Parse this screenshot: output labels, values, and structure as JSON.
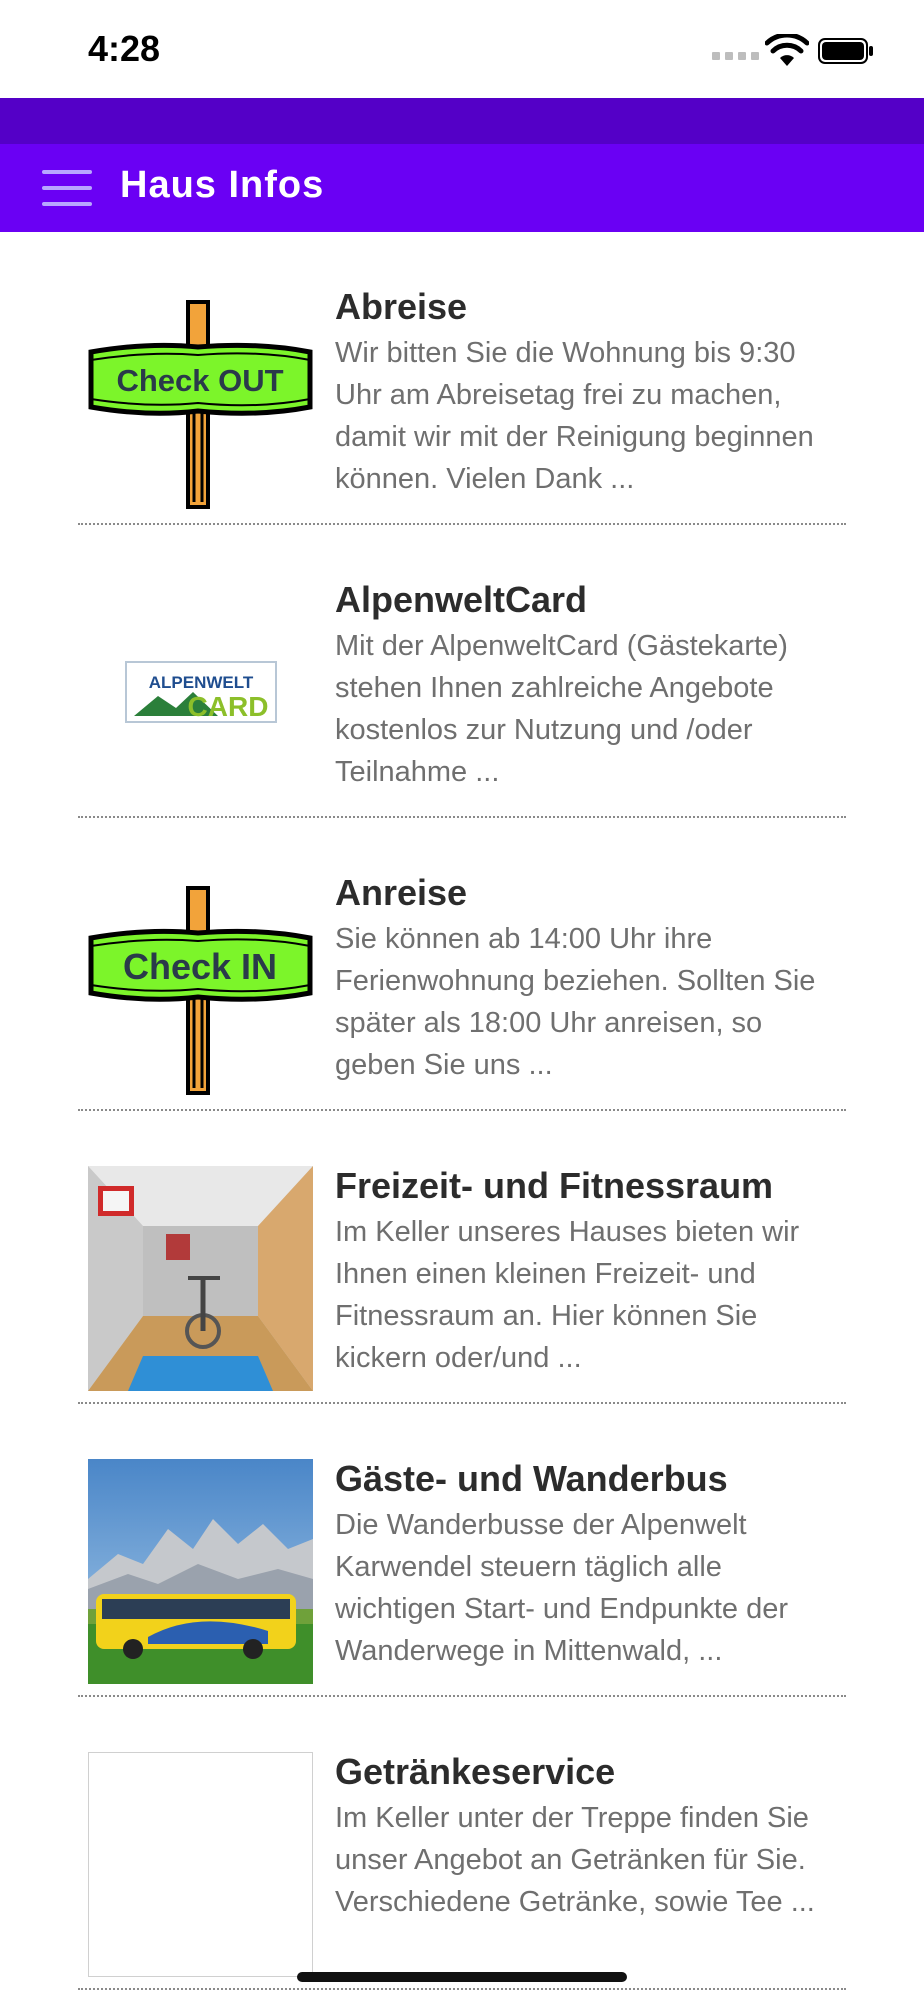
{
  "status": {
    "time": "4:28"
  },
  "header": {
    "title": "Haus Infos"
  },
  "items": [
    {
      "title": "Abreise",
      "desc": "Wir bitten Sie die Wohnung bis 9:30 Uhr am Abreisetag frei zu machen, damit wir mit der Reinigung beginnen können. Vielen Dank ...",
      "sign": "Check OUT"
    },
    {
      "title": "AlpenweltCard",
      "desc": "Mit der AlpenweltCard (Gästekarte) stehen Ihnen zahlreiche Angebote kostenlos zur Nutzung und /oder Teilnahme ...",
      "logo_top": "ALPENWELT",
      "logo_bottom": "CARD"
    },
    {
      "title": "Anreise",
      "desc": "Sie können ab 14:00 Uhr ihre Ferienwohnung beziehen. Sollten Sie später als 18:00 Uhr anreisen, so geben Sie uns ...",
      "sign": "Check IN"
    },
    {
      "title": "Freizeit- und Fitnessraum",
      "desc": "Im Keller unseres Hauses bieten wir Ihnen einen kleinen Freizeit- und Fitnessraum an. Hier können Sie kickern oder/und ..."
    },
    {
      "title": "Gäste- und Wanderbus",
      "desc": "Die Wanderbusse der Alpenwelt Karwendel steuern täglich alle wichtigen Start- und Endpunkte der Wanderwege in Mittenwald, ..."
    },
    {
      "title": "Getränkeservice",
      "desc": "Im Keller unter der Treppe finden Sie unser Angebot an Getränken für Sie. Verschiedene Getränke, sowie Tee ..."
    }
  ],
  "colors": {
    "appbar": "#6a00f4",
    "strip": "#5400c7",
    "sign_green": "#7cf52a"
  }
}
